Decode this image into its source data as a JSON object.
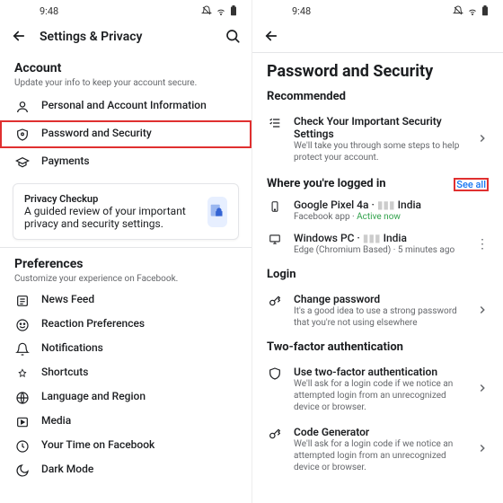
{
  "status": {
    "time": "9:48"
  },
  "left": {
    "appbar_title": "Settings & Privacy",
    "account": {
      "title": "Account",
      "sub": "Update your info to keep your account secure.",
      "items": [
        {
          "label": "Personal and Account Information"
        },
        {
          "label": "Password and Security"
        },
        {
          "label": "Payments"
        }
      ]
    },
    "privacy_card": {
      "title": "Privacy Checkup",
      "sub": "A guided review of your important privacy and security settings."
    },
    "preferences": {
      "title": "Preferences",
      "sub": "Customize your experience on Facebook.",
      "items": [
        {
          "label": "News Feed"
        },
        {
          "label": "Reaction Preferences"
        },
        {
          "label": "Notifications"
        },
        {
          "label": "Shortcuts"
        },
        {
          "label": "Language and Region"
        },
        {
          "label": "Media"
        },
        {
          "label": "Your Time on Facebook"
        },
        {
          "label": "Dark Mode"
        }
      ]
    }
  },
  "right": {
    "page_title": "Password and Security",
    "recommended": {
      "title": "Recommended",
      "item": {
        "label": "Check Your Important Security Settings",
        "sub": "We'll take you through some steps to help protect your account."
      }
    },
    "logged_in": {
      "title": "Where you're logged in",
      "see_all": "See all",
      "sessions": [
        {
          "title_a": "Google Pixel 4a · ",
          "title_b": " India",
          "sub_a": "Facebook app · ",
          "sub_b": "Active now"
        },
        {
          "title_a": "Windows PC · ",
          "title_b": " India",
          "sub": "Edge (Chromium Based) · 5 minutes ago"
        }
      ]
    },
    "login": {
      "title": "Login",
      "item": {
        "label": "Change password",
        "sub": "It's a good idea to use a strong password that you're not using elsewhere"
      }
    },
    "tfa": {
      "title": "Two-factor authentication",
      "items": [
        {
          "label": "Use two-factor authentication",
          "sub": "We'll ask for a login code if we notice an attempted login from an unrecognized device or browser."
        },
        {
          "label": "Code Generator",
          "sub": "We'll ask for a login code if we notice an attempted login from an unrecognized device or browser."
        }
      ]
    }
  }
}
